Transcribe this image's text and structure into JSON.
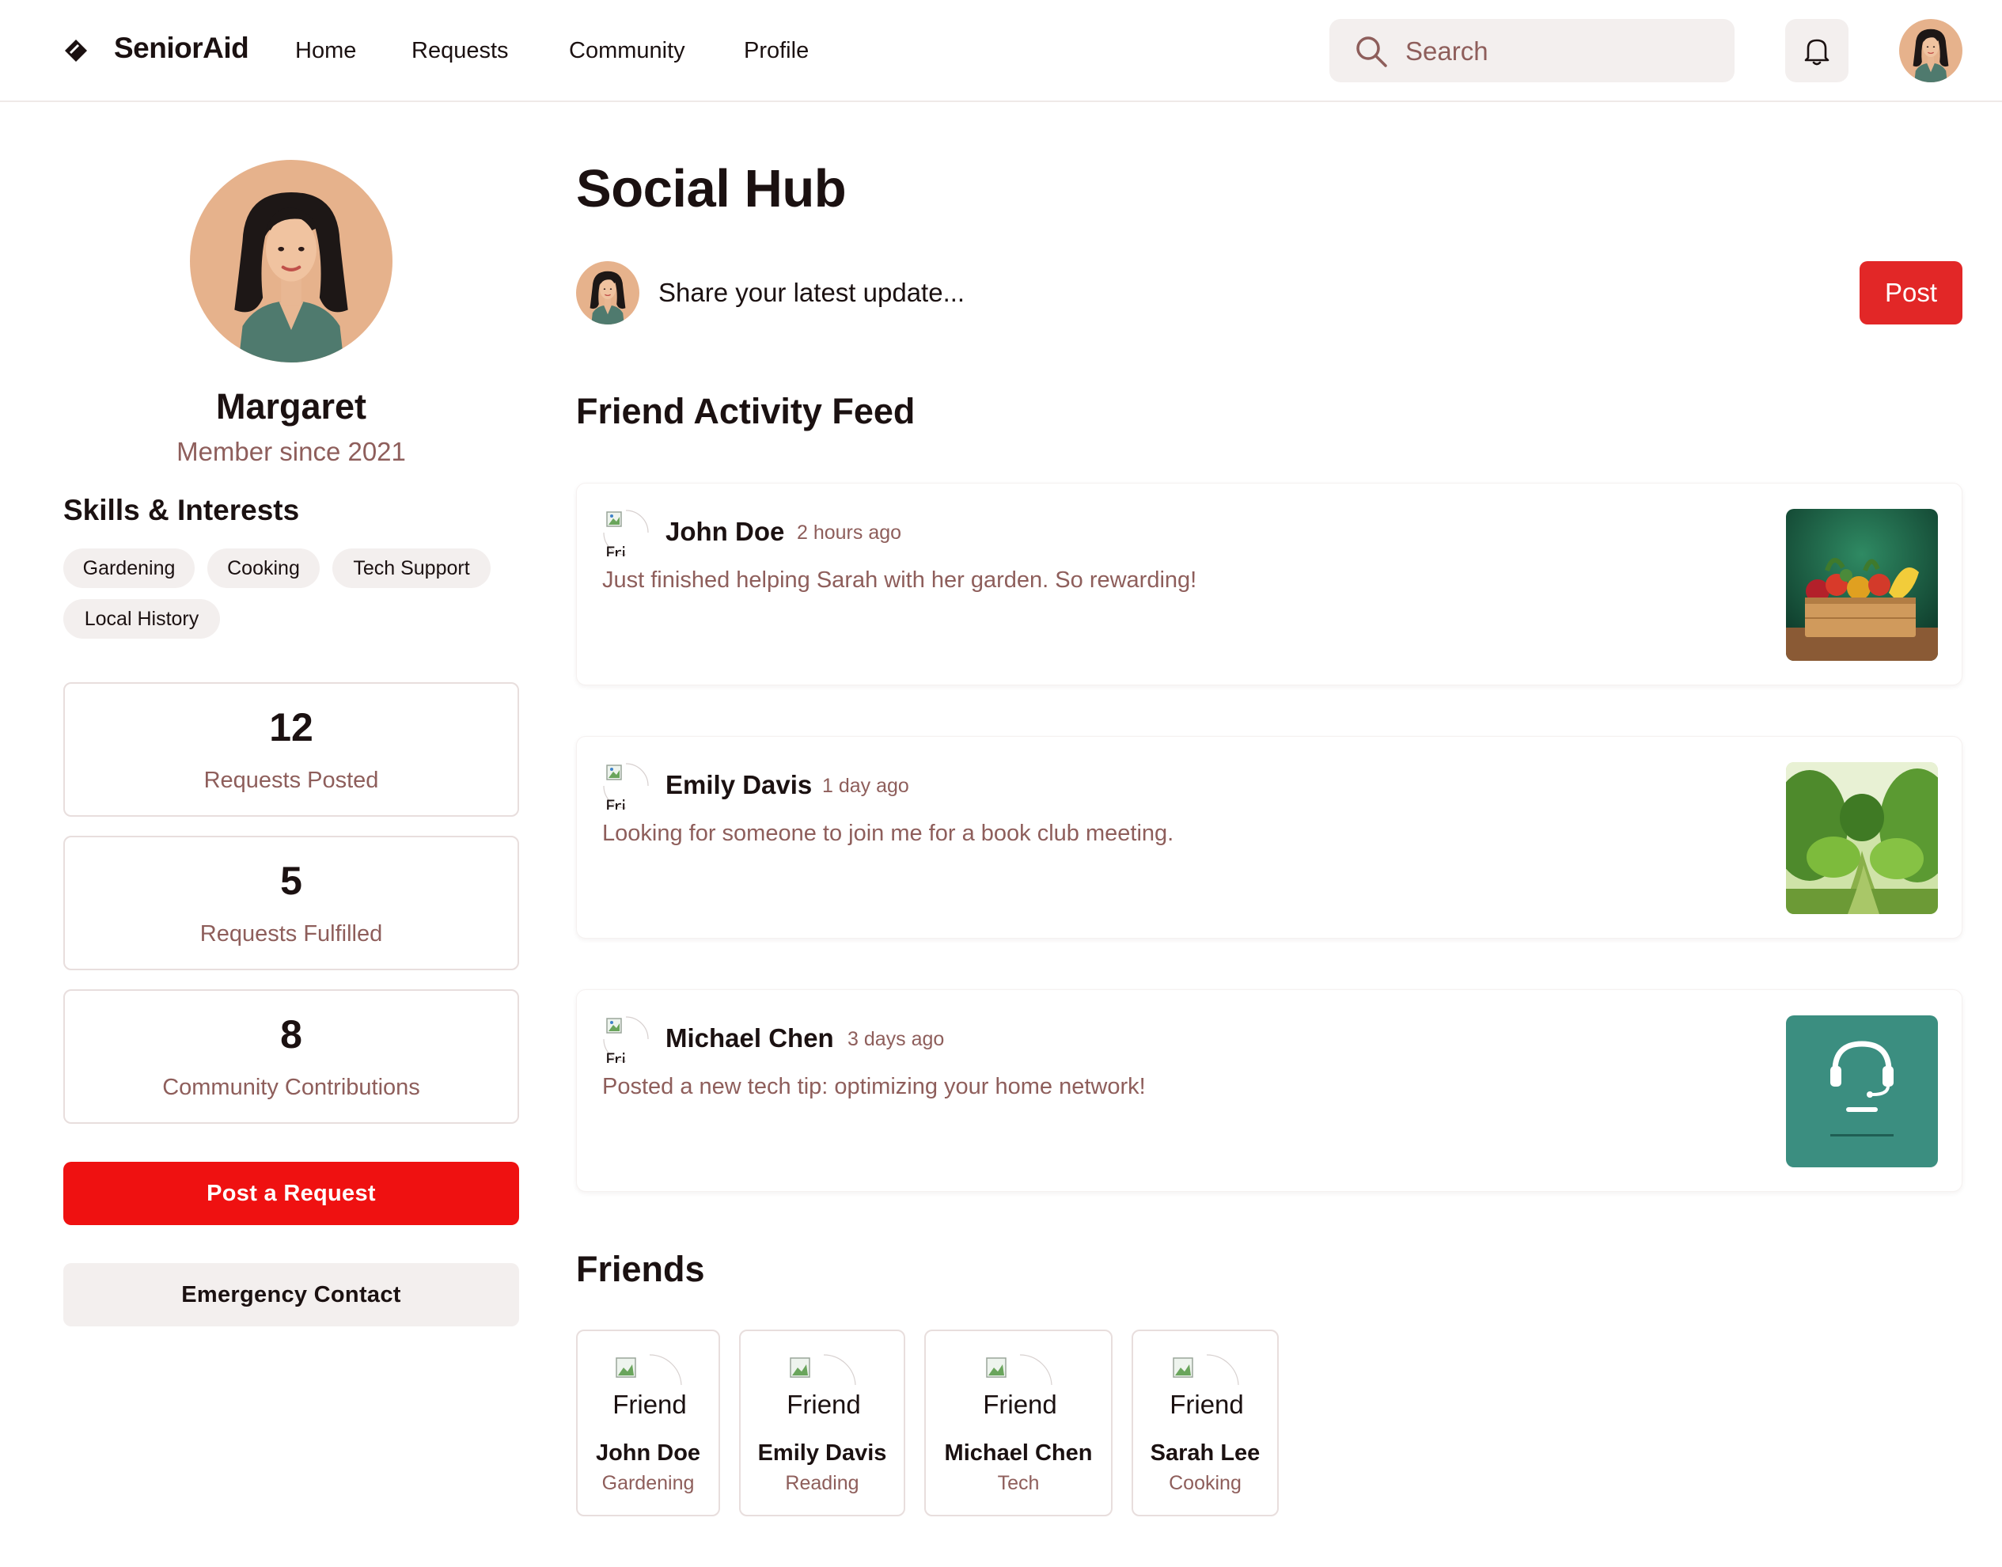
{
  "app": {
    "brand": "SeniorAid"
  },
  "nav": {
    "items": [
      {
        "label": "Home"
      },
      {
        "label": "Requests"
      },
      {
        "label": "Community"
      },
      {
        "label": "Profile"
      }
    ]
  },
  "search": {
    "placeholder": "Search"
  },
  "profile": {
    "name": "Margaret",
    "member_since": "Member since 2021",
    "skills_title": "Skills & Interests",
    "skills": [
      "Gardening",
      "Cooking",
      "Tech Support",
      "Local History"
    ],
    "stats": [
      {
        "value": "12",
        "label": "Requests Posted"
      },
      {
        "value": "5",
        "label": "Requests Fulfilled"
      },
      {
        "value": "8",
        "label": "Community Contributions"
      }
    ],
    "primary_action": "Post a Request",
    "secondary_action": "Emergency Contact"
  },
  "main": {
    "title": "Social Hub",
    "composer": {
      "placeholder": "Share your latest update...",
      "post_label": "Post"
    },
    "feed_title": "Friend Activity Feed",
    "feed": [
      {
        "name": "John Doe",
        "time": "2 hours ago",
        "text": "Just finished helping Sarah with her garden. So rewarding!",
        "avatar_alt": "Friend",
        "thumb": "vegetable-crate"
      },
      {
        "name": "Emily Davis",
        "time": "1 day ago",
        "text": "Looking for someone to join me for a book club meeting.",
        "avatar_alt": "Friend",
        "thumb": "garden-hedges"
      },
      {
        "name": "Michael Chen",
        "time": "3 days ago",
        "text": "Posted a new tech tip: optimizing your home network!",
        "avatar_alt": "Friend",
        "thumb": "tech-support-headset"
      }
    ],
    "friends_title": "Friends",
    "friends": [
      {
        "name": "John Doe",
        "skill": "Gardening",
        "avatar_alt": "Friend"
      },
      {
        "name": "Emily Davis",
        "skill": "Reading",
        "avatar_alt": "Friend"
      },
      {
        "name": "Michael Chen",
        "skill": "Tech",
        "avatar_alt": "Friend"
      },
      {
        "name": "Sarah Lee",
        "skill": "Cooking",
        "avatar_alt": "Friend"
      }
    ]
  },
  "colors": {
    "primary_red": "#ef1111",
    "post_red": "#e22727",
    "muted_text": "#8e5e5b",
    "chip_bg": "#f3efee",
    "border": "#e8dedd"
  }
}
